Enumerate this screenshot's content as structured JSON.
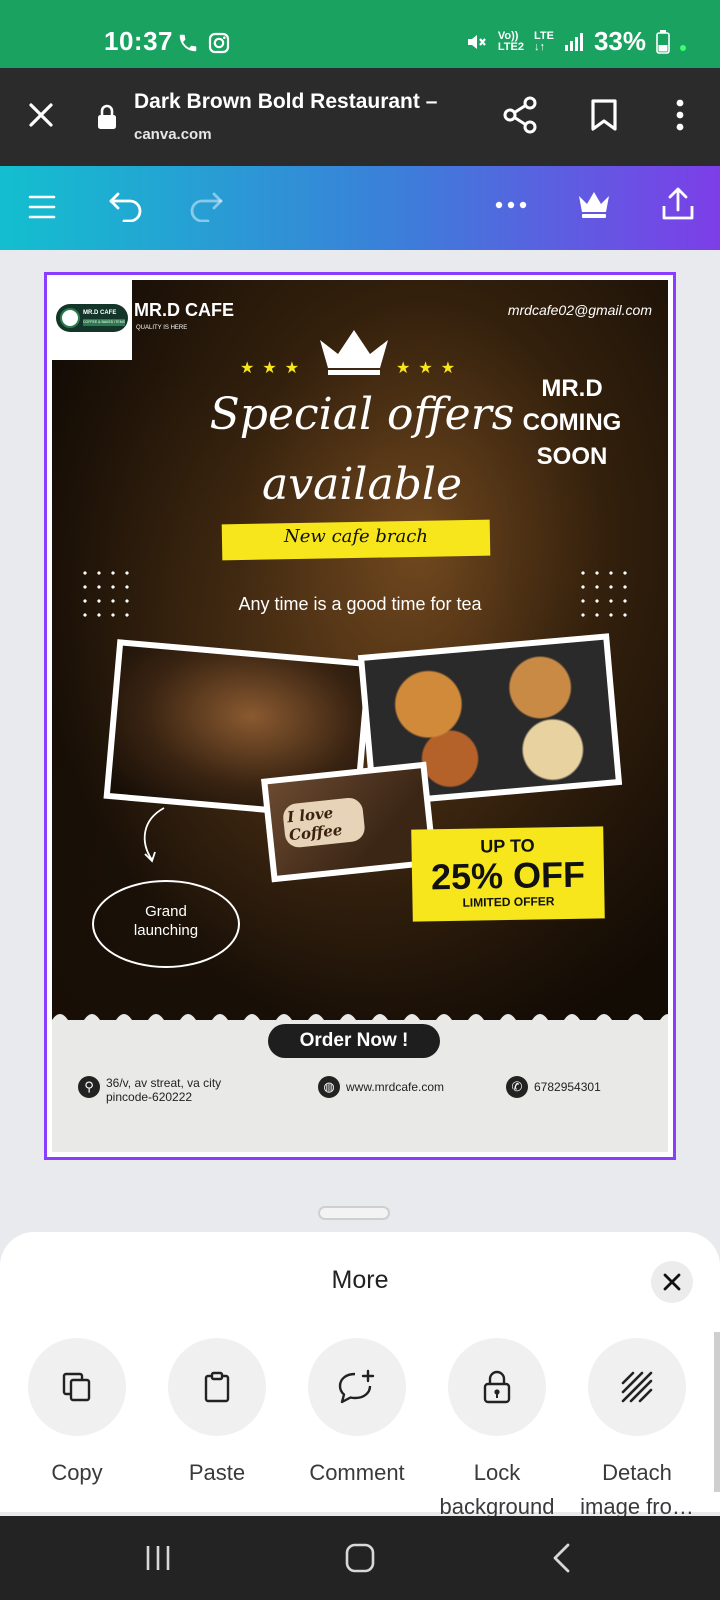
{
  "status_bar": {
    "time": "10:37",
    "network_top": "Vo))",
    "network_bottom": "LTE2",
    "lte_top": "LTE",
    "battery": "33%"
  },
  "browser": {
    "page_title": "Dark Brown Bold Restaurant  –",
    "url": "canva.com"
  },
  "design": {
    "logo_name": "MR.D CAFE",
    "logo_sub": "COFFEE & BAKED ITEMS",
    "brand_name": "MR.D CAFE",
    "brand_tagline": "QUALITY IS HERE",
    "email": "mrdcafe02@gmail.com",
    "coming_line1": "MR.D COMING",
    "coming_line2": "SOON",
    "special_line1": "Special offers",
    "special_line2": "available",
    "band_text": "New cafe brach",
    "tagline": "Any time is a good time for tea",
    "coffee_text": "I love Coffee",
    "offer_up": "UP TO",
    "offer_percent": "25% OFF",
    "offer_limited": "LIMITED OFFER",
    "grand_line1": "Grand",
    "grand_line2": "launching",
    "order_button": "Order Now !",
    "address_line1": "36/v, av streat, va city",
    "address_line2": "pincode-620222",
    "website": "www.mrdcafe.com",
    "phone": "6782954301"
  },
  "sheet": {
    "title": "More",
    "actions": [
      {
        "label": "Copy",
        "icon": "copy-icon"
      },
      {
        "label": "Paste",
        "icon": "paste-icon"
      },
      {
        "label": "Comment",
        "icon": "comment-add-icon"
      },
      {
        "label": "Lock",
        "label2": "background",
        "icon": "lock-icon"
      },
      {
        "label": "Detach",
        "label2": "image fro…",
        "icon": "detach-image-icon"
      }
    ]
  },
  "colors": {
    "status_green": "#1aa260",
    "selection_purple": "#8b3dff",
    "promo_yellow": "#f6e61b"
  }
}
